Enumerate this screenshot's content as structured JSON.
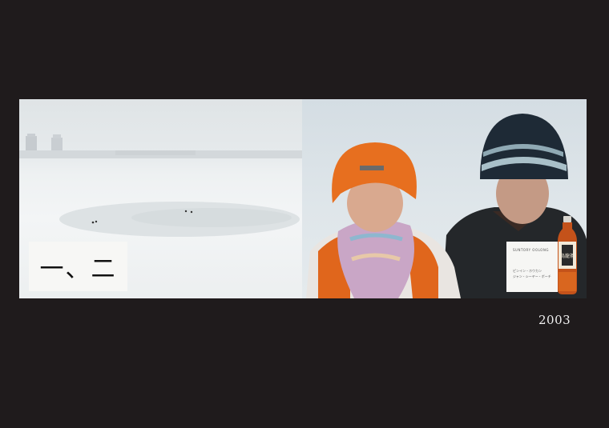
{
  "poster": {
    "film_title": "一、二",
    "year": "2003"
  },
  "product_card": {
    "brand_line": "SUNTORY OOLONG",
    "caption_line1": "ピンイン・ホウカン",
    "caption_line2": "ジャン・シーヤー・ボーチ",
    "bottle_label": "烏龍茶"
  }
}
